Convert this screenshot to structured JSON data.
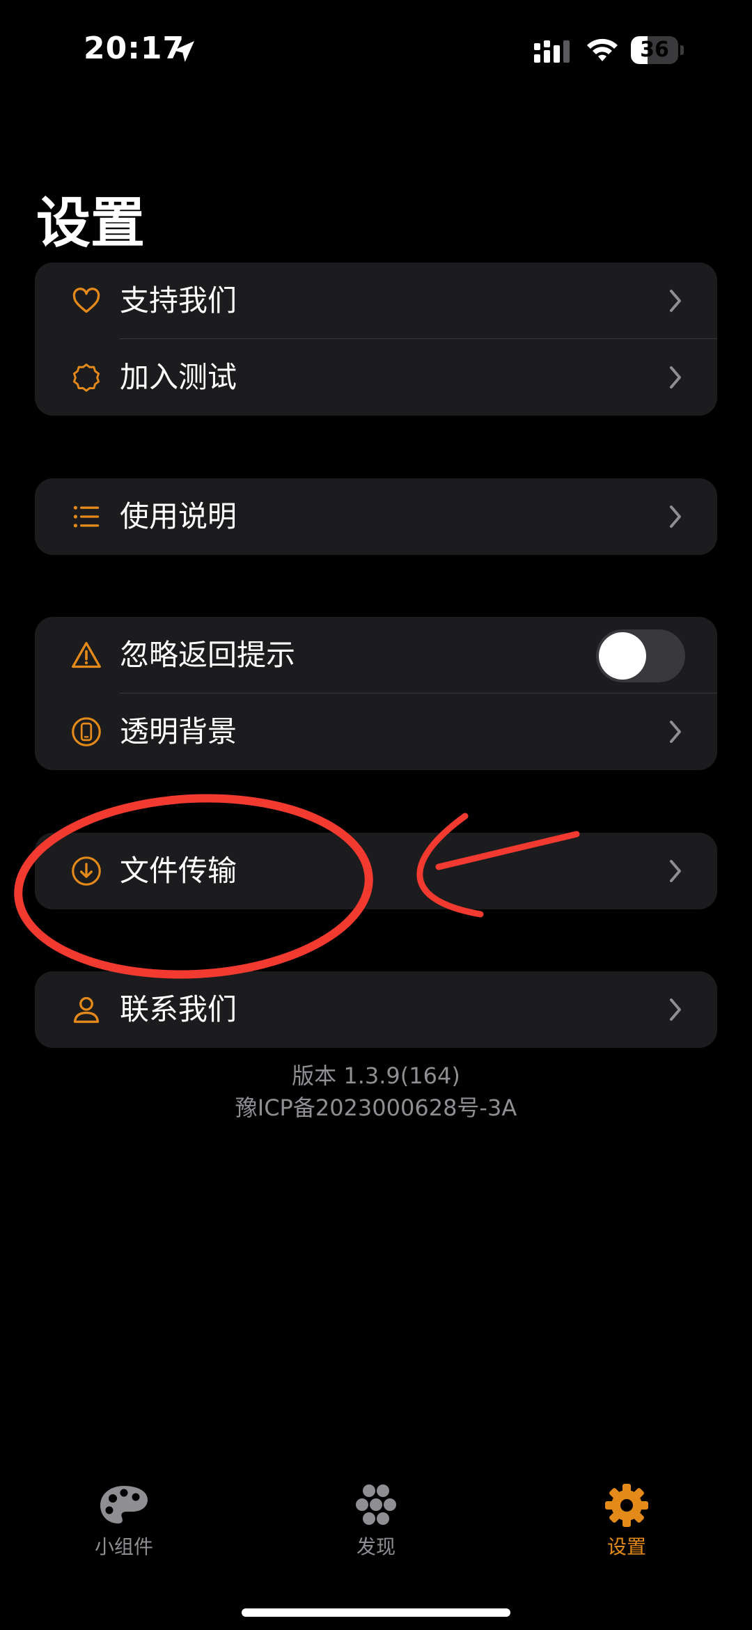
{
  "status_bar": {
    "time": "20:17",
    "battery": "36",
    "battery_level": 0.36
  },
  "page": {
    "title": "设置"
  },
  "groups": [
    {
      "items": [
        {
          "label": "支持我们",
          "icon": "heart-icon"
        },
        {
          "label": "加入测试",
          "icon": "badge-icon"
        }
      ]
    },
    {
      "items": [
        {
          "label": "使用说明",
          "icon": "list-icon"
        }
      ]
    },
    {
      "items": [
        {
          "label": "忽略返回提示",
          "icon": "warning-icon",
          "toggle": false
        },
        {
          "label": "透明背景",
          "icon": "phone-icon"
        }
      ]
    },
    {
      "items": [
        {
          "label": "文件传输",
          "icon": "download-icon"
        }
      ]
    },
    {
      "items": [
        {
          "label": "联系我们",
          "icon": "person-icon"
        }
      ]
    }
  ],
  "footer": {
    "version": "版本 1.3.9(164)",
    "icp": "豫ICP备2023000628号-3A"
  },
  "tabbar": {
    "items": [
      {
        "label": "小组件",
        "icon": "palette-icon",
        "active": false
      },
      {
        "label": "发现",
        "icon": "flower-icon",
        "active": false
      },
      {
        "label": "设置",
        "icon": "gear-icon",
        "active": true
      }
    ]
  },
  "colors": {
    "accent": "#e48a1a",
    "background": "#000000",
    "card": "#1c1c1e",
    "annotation": "#f23a30",
    "inactive": "#8e8e93"
  }
}
